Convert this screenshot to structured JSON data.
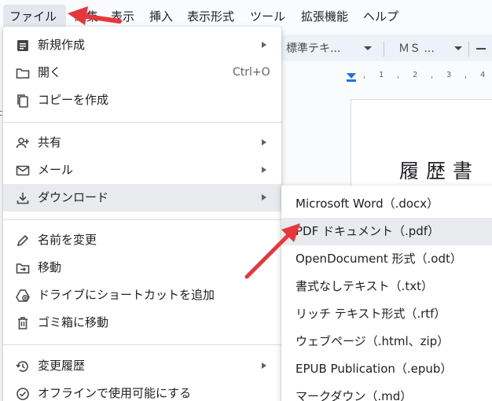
{
  "menubar": {
    "items": [
      "ファイル",
      "編集",
      "表示",
      "挿入",
      "表示形式",
      "ツール",
      "拡張機能",
      "ヘルプ"
    ]
  },
  "toolbar": {
    "style_value": "標準テキ...",
    "font_value": "ＭＳ ..."
  },
  "ruler": {
    "numbers": [
      "1",
      "2",
      "3",
      "4"
    ]
  },
  "document": {
    "title": "履歴書"
  },
  "file_menu": {
    "new": "新規作成",
    "open": "開く",
    "open_shortcut": "Ctrl+O",
    "copy": "コピーを作成",
    "share": "共有",
    "email": "メール",
    "download": "ダウンロード",
    "rename": "名前を変更",
    "move": "移動",
    "add_shortcut": "ドライブにショートカットを追加",
    "trash": "ゴミ箱に移動",
    "version_history": "変更履歴",
    "offline": "オフラインで使用可能にする"
  },
  "download_submenu": {
    "items": [
      "Microsoft Word（.docx）",
      "PDF ドキュメント（.pdf）",
      "OpenDocument 形式（.odt）",
      "書式なしテキスト（.txt）",
      "リッチ テキスト形式（.rtf）",
      "ウェブページ（.html、zip）",
      "EPUB Publication（.epub）",
      "マークダウン（.md）"
    ]
  },
  "colors": {
    "annotation_red": "#e8373c",
    "highlight": "#e8eaed",
    "accent_blue": "#1a73e8"
  },
  "icons": [
    "doc-icon",
    "folder-icon",
    "copy-icon",
    "person-add-icon",
    "mail-icon",
    "download-icon",
    "pencil-icon",
    "move-icon",
    "drive-shortcut-icon",
    "trash-icon",
    "history-icon",
    "offline-icon"
  ]
}
